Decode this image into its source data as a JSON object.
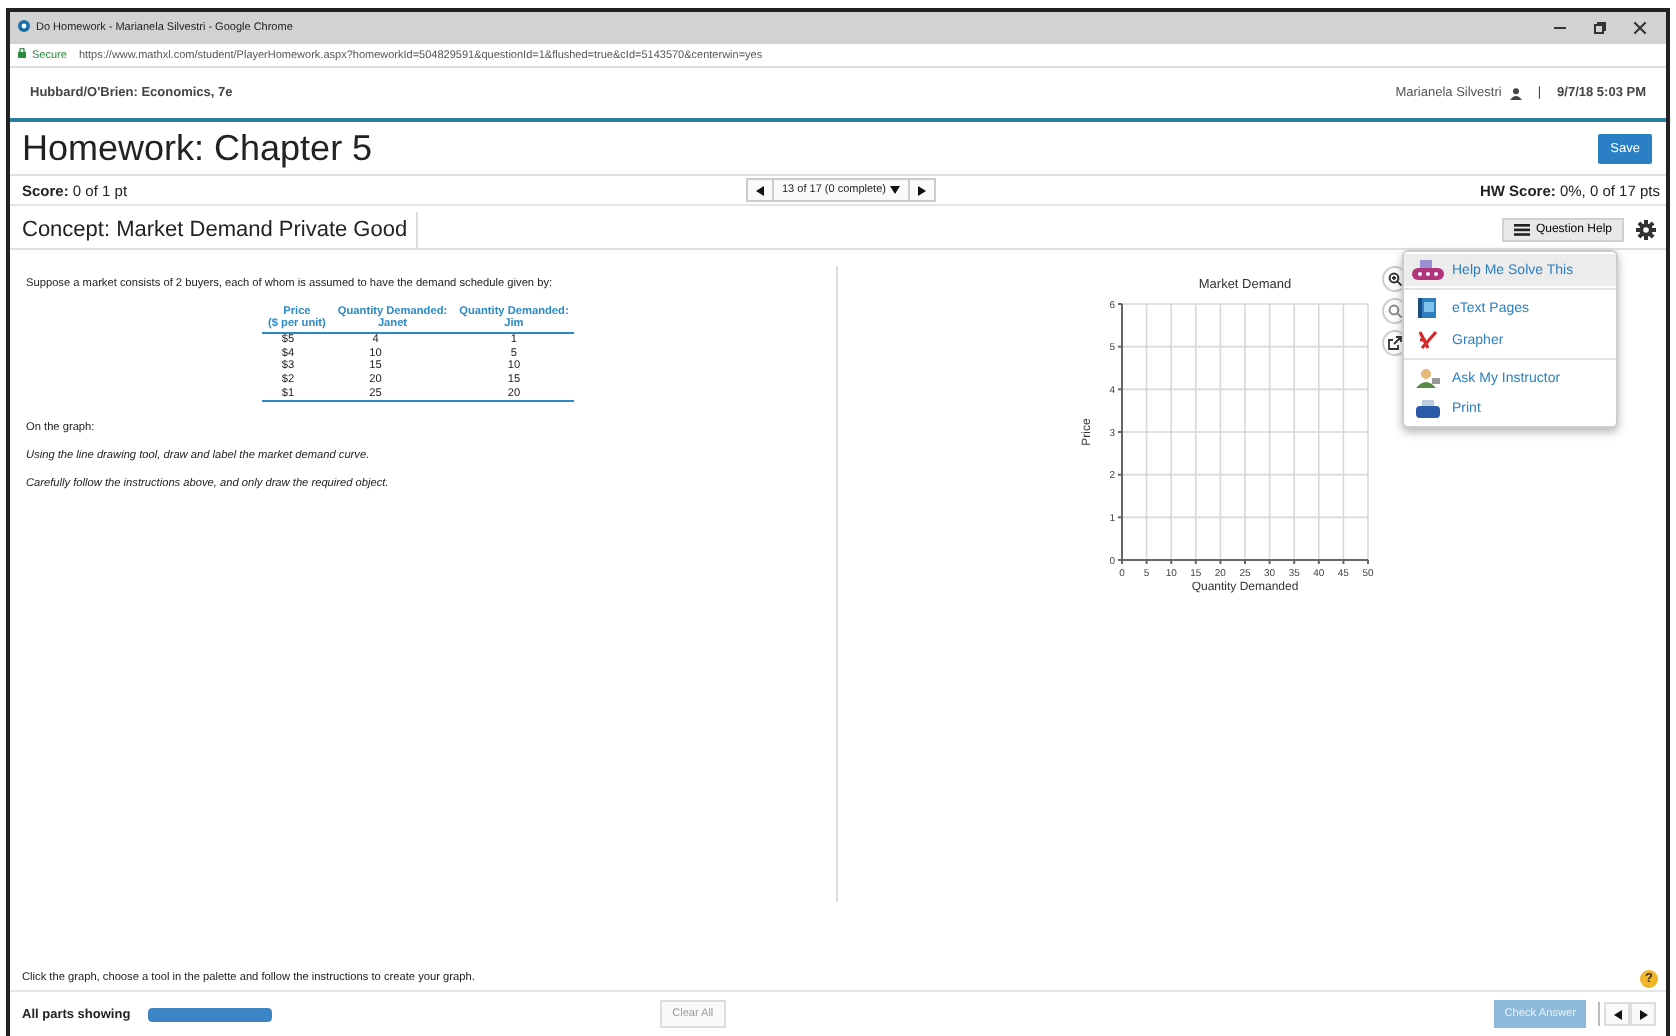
{
  "browser": {
    "title": "Do Homework - Marianela Silvestri - Google Chrome",
    "secure_label": "Secure",
    "url": "https://www.mathxl.com/student/PlayerHomework.aspx?homeworkId=504829591&questionId=1&flushed=true&cId=5143570&centerwin=yes"
  },
  "header": {
    "book": "Hubbard/O'Brien: Economics, 7e",
    "user": "Marianela Silvestri",
    "separator": "|",
    "datetime": "9/7/18 5:03 PM"
  },
  "homework": {
    "title": "Homework: Chapter 5",
    "save_button": "Save"
  },
  "score": {
    "label": "Score:",
    "value": "0 of 1 pt",
    "navigator": "13 of 17 (0 complete)",
    "hw_label": "HW Score:",
    "hw_value": "0%, 0 of 17 pts"
  },
  "concept": "Concept: Market Demand Private Good",
  "question_help": "Question Help",
  "help_menu": [
    {
      "label": "Help Me Solve This",
      "kind": "solve",
      "selected": true
    },
    {
      "label": "eText Pages",
      "kind": "book",
      "selected": false
    },
    {
      "label": "Grapher",
      "kind": "grapher",
      "selected": false
    },
    {
      "label": "Ask My Instructor",
      "kind": "instructor",
      "selected": false
    },
    {
      "label": "Print",
      "kind": "print",
      "selected": false
    }
  ],
  "question": {
    "intro": "Suppose a market consists of 2 buyers, each of whom is assumed to have the demand schedule given by:",
    "table": {
      "columns": [
        {
          "title": "Price",
          "subtitle": "($ per unit)"
        },
        {
          "title": "Quantity Demanded:",
          "subtitle": "Janet"
        },
        {
          "title": "Quantity Demanded:",
          "subtitle": "Jim"
        }
      ],
      "rows": [
        [
          "$5",
          "4",
          "1"
        ],
        [
          "$4",
          "10",
          "5"
        ],
        [
          "$3",
          "15",
          "10"
        ],
        [
          "$2",
          "20",
          "15"
        ],
        [
          "$1",
          "25",
          "20"
        ]
      ]
    },
    "paragraphs": [
      {
        "text": "On the graph:",
        "kind": "plain"
      },
      {
        "text": "Using the line drawing tool, draw and label the market demand curve.",
        "kind": "italic"
      },
      {
        "text": "Carefully follow the instructions above, and only draw the required object.",
        "kind": "italic"
      }
    ]
  },
  "graph": {
    "chart_data": {
      "type": "line",
      "title": "Market Demand",
      "xlabel": "Quantity Demanded",
      "ylabel": "Price",
      "xlim": [
        0,
        50
      ],
      "ylim": [
        0,
        6
      ],
      "xticks": [
        0,
        5,
        10,
        15,
        20,
        25,
        30,
        35,
        40,
        45,
        50
      ],
      "yticks": [
        0,
        1,
        2,
        3,
        4,
        5,
        6
      ],
      "grid": true
    }
  },
  "footer": {
    "instruction": "Click the graph, choose a tool in the palette and follow the instructions to create your graph.",
    "help_icon": "?",
    "parts_label": "All parts showing",
    "parts_progress": {
      "level": 1
    },
    "clear_button": {
      "label": "Clear All",
      "disabled": true
    },
    "check_button": {
      "label": "Check Answer",
      "disabled": true
    }
  }
}
